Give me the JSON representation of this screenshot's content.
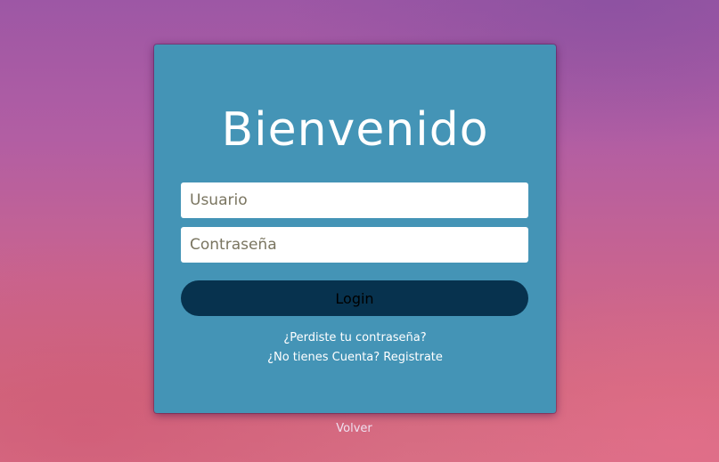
{
  "login": {
    "title": "Bienvenido",
    "username_placeholder": "Usuario",
    "password_placeholder": "Contraseña",
    "login_label": "Login",
    "forgot_password_label": "¿Perdiste tu contraseña?",
    "register_label": "¿No tienes Cuenta? Registrate"
  },
  "footer": {
    "back_label": "Volver"
  },
  "colors": {
    "card_background": "#4494b6",
    "button_background": "#07324e",
    "input_background": "#ffffff",
    "text_light": "#ffffff"
  }
}
